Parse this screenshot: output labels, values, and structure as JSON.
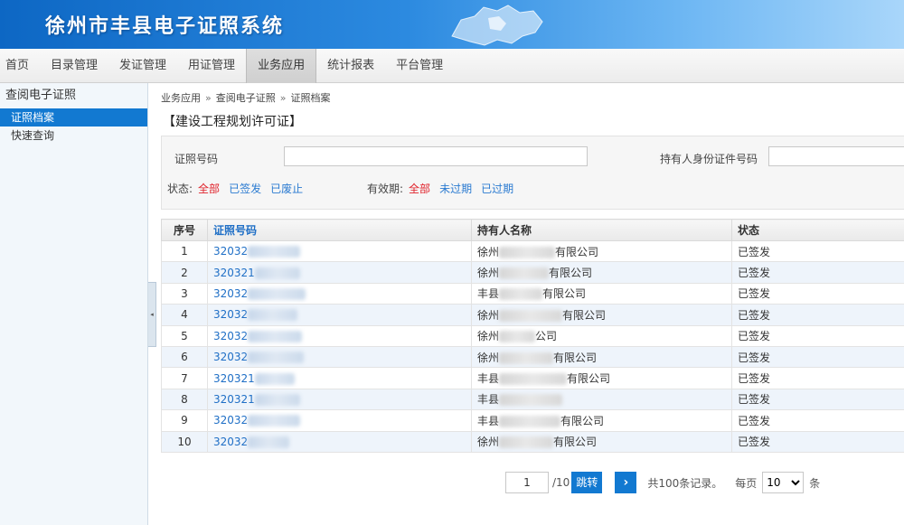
{
  "header": {
    "title": "徐州市丰县电子证照系统"
  },
  "nav": {
    "items": [
      {
        "label": "首页"
      },
      {
        "label": "目录管理"
      },
      {
        "label": "发证管理"
      },
      {
        "label": "用证管理"
      },
      {
        "label": "业务应用",
        "active": true
      },
      {
        "label": "统计报表"
      },
      {
        "label": "平台管理"
      }
    ]
  },
  "sidebar": {
    "heading": "查阅电子证照",
    "items": [
      {
        "label": "证照档案",
        "active": true
      },
      {
        "label": "快速查询"
      }
    ],
    "collapse_glyph": "◂"
  },
  "breadcrumb": {
    "items": [
      "业务应用",
      "查阅电子证照",
      "证照档案"
    ],
    "separator": "»"
  },
  "certificate_title": "【建设工程规划许可证】",
  "search": {
    "cert_no_label": "证照号码",
    "cert_no_value": "",
    "holder_id_label": "持有人身份证件号码",
    "holder_id_value": "",
    "status_label": "状态:",
    "status_options": [
      "全部",
      "已签发",
      "已废止"
    ],
    "validity_label": "有效期:",
    "validity_options": [
      "全部",
      "未过期",
      "已过期"
    ]
  },
  "table": {
    "columns": [
      "序号",
      "证照号码",
      "持有人名称",
      "状态"
    ],
    "rows": [
      {
        "index": "1",
        "cert_prefix": "32032",
        "holder_prefix": "徐州",
        "holder_suffix": "有限公司",
        "status": "已签发"
      },
      {
        "index": "2",
        "cert_prefix": "320321",
        "holder_prefix": "徐州",
        "holder_suffix": "有限公司",
        "status": "已签发"
      },
      {
        "index": "3",
        "cert_prefix": "32032",
        "holder_prefix": "丰县",
        "holder_suffix": "有限公司",
        "status": "已签发"
      },
      {
        "index": "4",
        "cert_prefix": "32032",
        "holder_prefix": "徐州",
        "holder_suffix": "有限公司",
        "status": "已签发"
      },
      {
        "index": "5",
        "cert_prefix": "32032",
        "holder_prefix": "徐州",
        "holder_suffix": "公司",
        "status": "已签发"
      },
      {
        "index": "6",
        "cert_prefix": "32032",
        "holder_prefix": "徐州",
        "holder_suffix": "有限公司",
        "status": "已签发"
      },
      {
        "index": "7",
        "cert_prefix": "320321",
        "holder_prefix": "丰县",
        "holder_suffix": "有限公司",
        "status": "已签发"
      },
      {
        "index": "8",
        "cert_prefix": "320321",
        "holder_prefix": "丰县",
        "holder_suffix": "",
        "status": "已签发"
      },
      {
        "index": "9",
        "cert_prefix": "32032",
        "holder_prefix": "丰县",
        "holder_suffix": "有限公司",
        "status": "已签发"
      },
      {
        "index": "10",
        "cert_prefix": "32032",
        "holder_prefix": "徐州",
        "holder_suffix": "有限公司",
        "status": "已签发"
      }
    ]
  },
  "pager": {
    "current_page": "1",
    "total_pages": "/10",
    "jump_label": "跳转",
    "next_glyph": "›",
    "records_text": "共100条记录。",
    "per_page_label": "每页",
    "per_page_value": "10",
    "per_page_unit": "条"
  },
  "colors": {
    "accent": "#1279d1",
    "link": "#1f6fc6",
    "selected_filter": "#e0212a"
  }
}
